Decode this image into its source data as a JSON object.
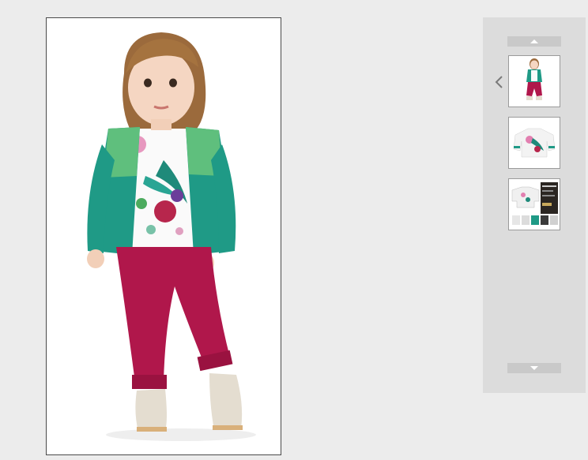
{
  "product_gallery": {
    "main_image": {
      "subject": "child-in-teal-cardigan-and-red-pants"
    },
    "thumbnails": [
      {
        "subject": "full-outfit"
      },
      {
        "subject": "floral-top"
      },
      {
        "subject": "product-page-preview"
      }
    ],
    "icons": {
      "scroll_up": "triangle-up-icon",
      "scroll_down": "triangle-down-icon",
      "previous": "chevron-left-icon"
    },
    "colors": {
      "page_background": "#ececec",
      "panel_background": "#dcdcdc",
      "scroll_button": "#c9c9c9",
      "cardigan": "#1f9a86",
      "pants": "#b0174b"
    }
  }
}
